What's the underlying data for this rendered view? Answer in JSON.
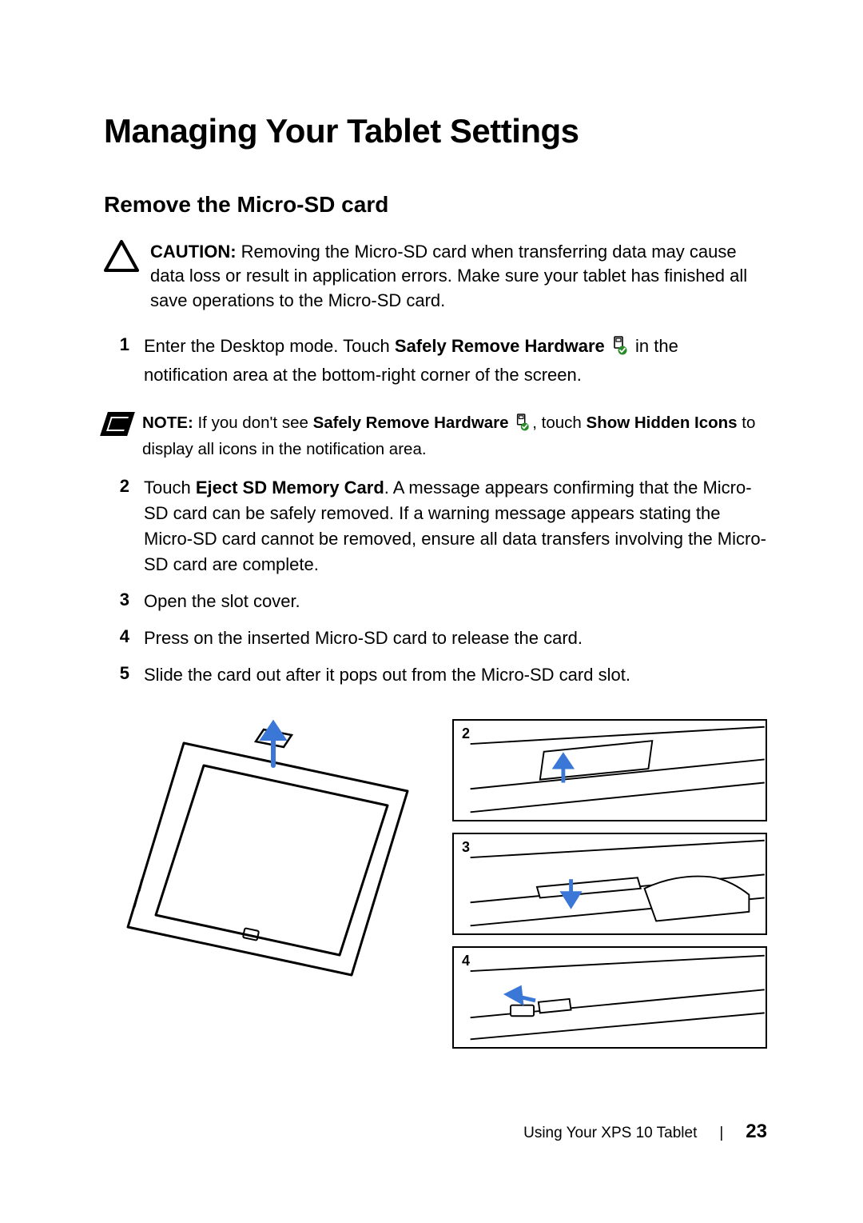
{
  "title": "Managing Your Tablet Settings",
  "subtitle": "Remove the Micro-SD card",
  "caution": {
    "label": "CAUTION:",
    "text": " Removing the Micro-SD card when transferring data may cause data loss or result in application errors. Make sure your tablet has finished all save operations to the Micro-SD card."
  },
  "step1": {
    "num": "1",
    "pre": "Enter the Desktop mode. Touch ",
    "bold": "Safely Remove Hardware",
    "post": " in the notification area at the bottom-right corner of the screen."
  },
  "note": {
    "label": "NOTE:",
    "pre": " If you don't see ",
    "bold1": "Safely Remove Hardware",
    "mid": ", touch ",
    "bold2": "Show Hidden Icons",
    "post": " to display all icons in the notification area."
  },
  "step2": {
    "num": "2",
    "pre": "Touch ",
    "bold": "Eject SD Memory Card",
    "post": ". A message appears confirming that the Micro-SD card can be safely removed. If a warning message appears stating the Micro-SD card cannot be removed, ensure all data transfers involving the Micro-SD card are complete."
  },
  "step3": {
    "num": "3",
    "text": "Open the slot cover."
  },
  "step4": {
    "num": "4",
    "text": "Press on the inserted Micro-SD card to release the card."
  },
  "step5": {
    "num": "5",
    "text": "Slide the card out after it pops out from the Micro-SD card slot."
  },
  "panels": {
    "p2": "2",
    "p3": "3",
    "p4": "4"
  },
  "footer": {
    "section": "Using Your XPS 10 Tablet",
    "sep": "|",
    "page": "23"
  }
}
